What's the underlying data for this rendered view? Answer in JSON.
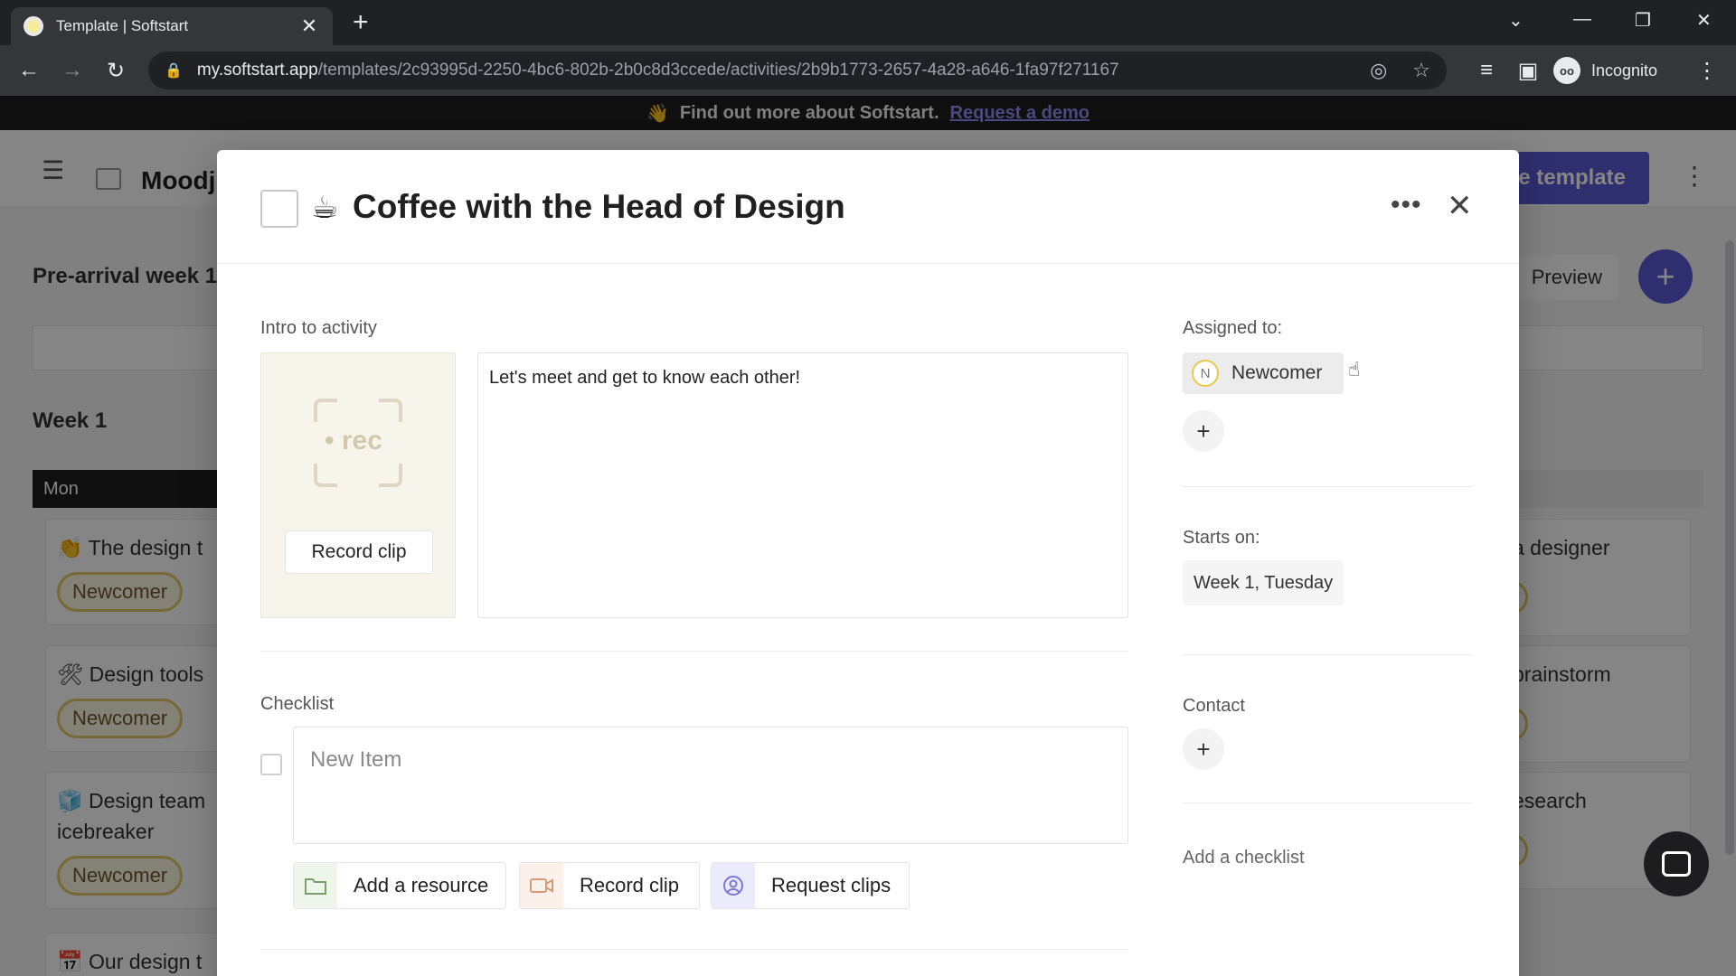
{
  "browser": {
    "tab_title": "Template | Softstart",
    "url_host": "my.softstart.app",
    "url_path": "/templates/2c93995d-2250-4bc6-802b-2b0c8d3ccede/activities/2b9b1773-2657-4a28-a646-1fa97f271167",
    "profile_label": "Incognito"
  },
  "banner": {
    "text": "Find out more about Softstart.",
    "link": "Request a demo"
  },
  "background": {
    "board_title": "Moodj",
    "use_template_label": "e template",
    "pre_arrival_title": "Pre-arrival week 1",
    "preview_label": "Preview",
    "week_title": "Week 1",
    "day_label": "Mon",
    "cards": [
      {
        "emoji": "👏",
        "title": "The design t",
        "pill": "Newcomer"
      },
      {
        "emoji": "🛠",
        "title": "Design tools",
        "pill": "Newcomer"
      },
      {
        "emoji": "🧊",
        "title": "Design team icebreaker",
        "pill": "Newcomer"
      },
      {
        "emoji": "📅",
        "title": "Our design t",
        "pill": ""
      }
    ],
    "right_cards": [
      "a designer",
      "brainstorm",
      "esearch"
    ]
  },
  "modal": {
    "emoji": "☕",
    "title": "Coffee with the Head of Design",
    "intro_label": "Intro to activity",
    "rec_text": "rec",
    "record_clip_label": "Record clip",
    "intro_text": "Let's meet and get to know each other!",
    "checklist_label": "Checklist",
    "checklist_placeholder": "New Item",
    "actions": {
      "add_resource": "Add a resource",
      "record_clip": "Record clip",
      "request_clips": "Request clips"
    },
    "assigned_label": "Assigned to:",
    "assignee_initial": "N",
    "assignee_name": "Newcomer",
    "starts_label": "Starts on:",
    "starts_value": "Week 1, Tuesday",
    "contact_label": "Contact",
    "add_checklist_label": "Add a checklist"
  },
  "colors": {
    "accent": "#5b5bd6",
    "pill_border": "#e4c76a",
    "banner_link": "#8e8cf5"
  }
}
